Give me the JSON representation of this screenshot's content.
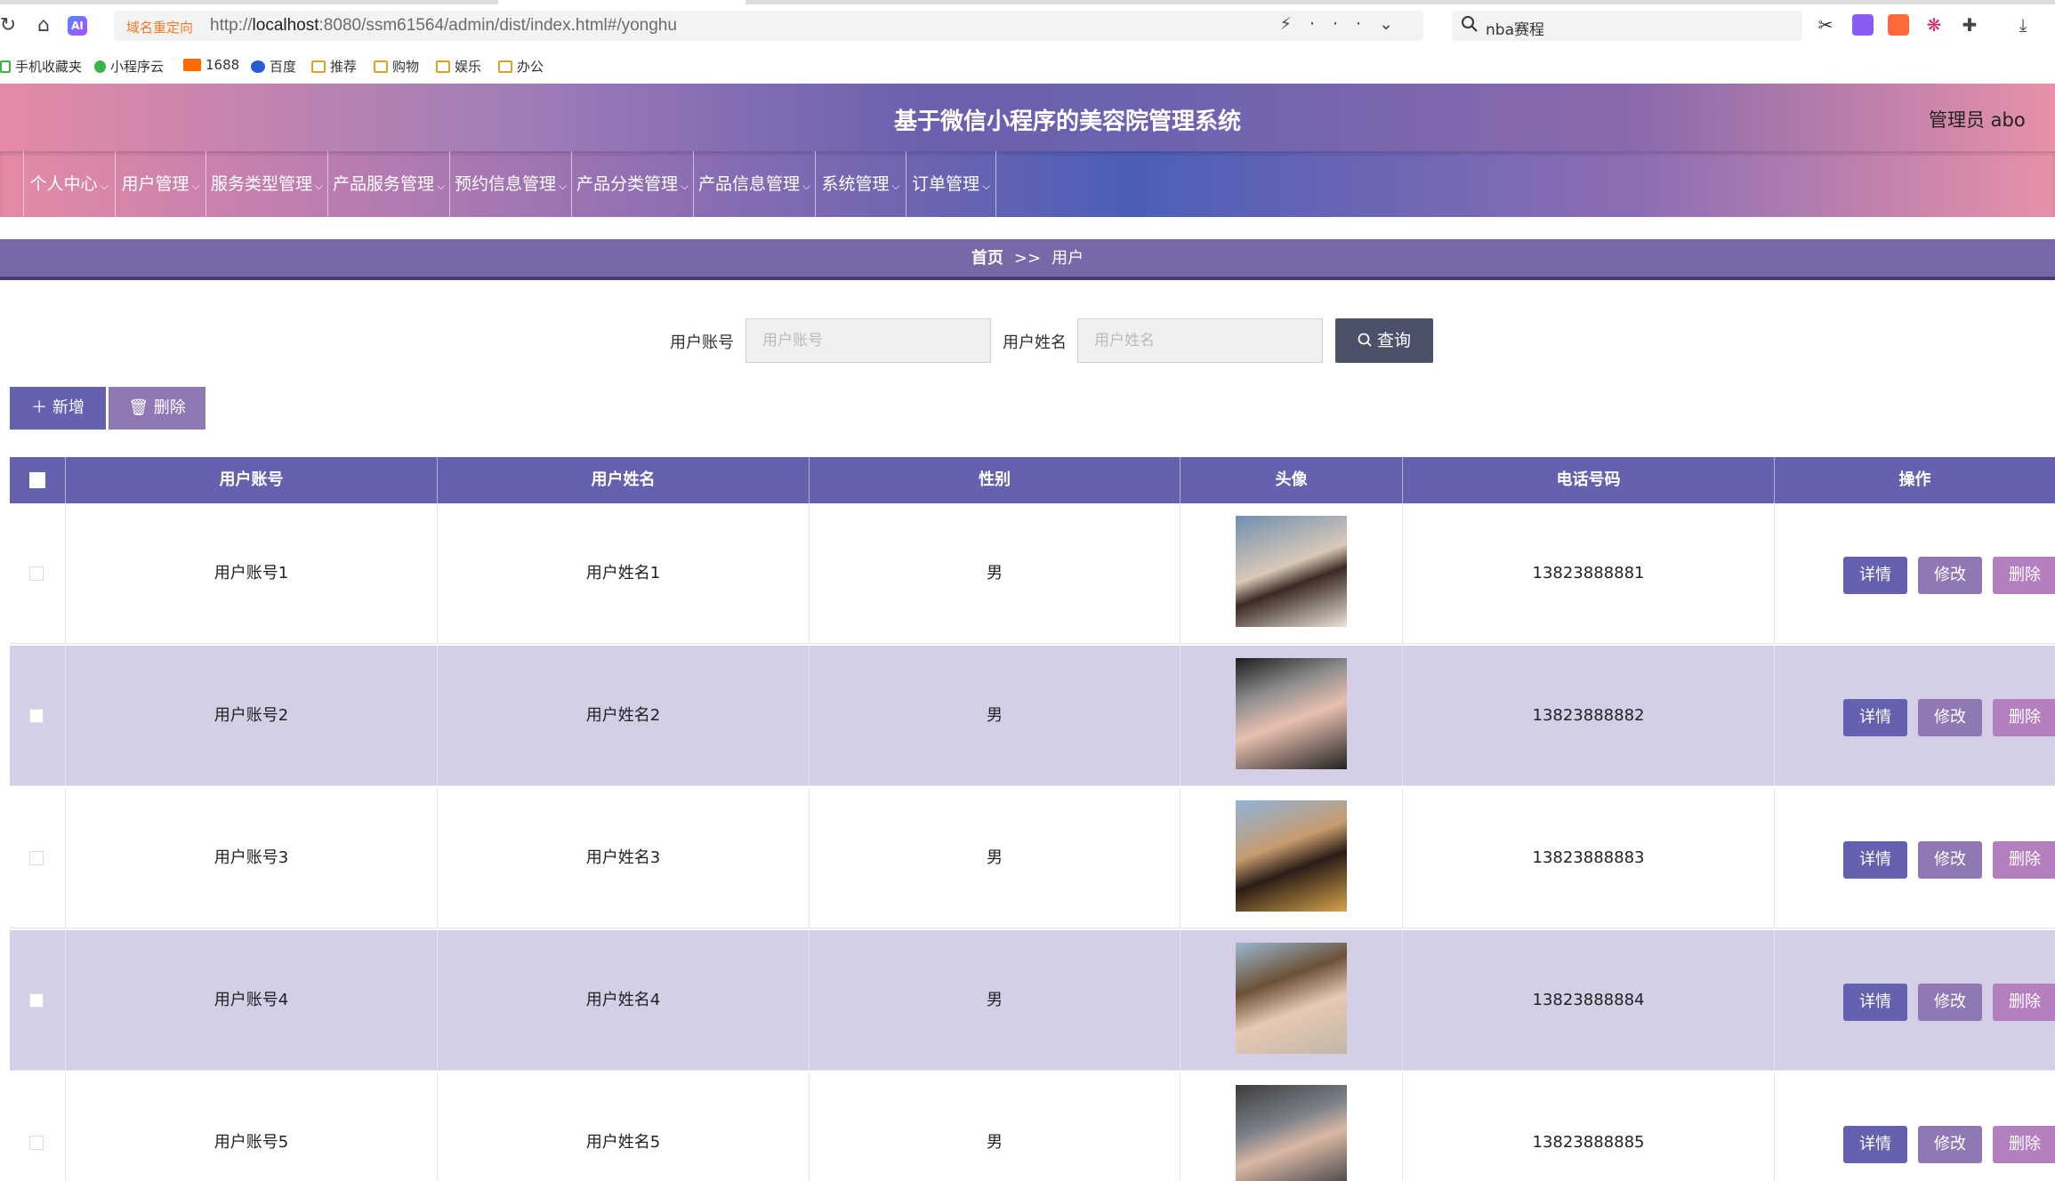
{
  "browser": {
    "redirect_label": "域名重定向",
    "url_prefix": "http://",
    "url_host": "localhost",
    "url_rest": ":8080/ssm61564/admin/dist/index.html#/yonghu",
    "search_query": "nba赛程",
    "bookmarks": [
      "手机收藏夹",
      "小程序云",
      "1688",
      "百度",
      "推荐",
      "购物",
      "娱乐",
      "办公"
    ]
  },
  "header": {
    "title": "基于微信小程序的美容院管理系统",
    "admin": "管理员 abo"
  },
  "menu": [
    "个人中心",
    "用户管理",
    "服务类型管理",
    "产品服务管理",
    "预约信息管理",
    "产品分类管理",
    "产品信息管理",
    "系统管理",
    "订单管理"
  ],
  "breadcrumb": {
    "home": "首页",
    "sep": ">>",
    "current": "用户"
  },
  "search": {
    "account_label": "用户账号",
    "account_placeholder": "用户账号",
    "name_label": "用户姓名",
    "name_placeholder": "用户姓名",
    "query_button": "查询"
  },
  "toolbar": {
    "add": "新增",
    "delete": "删除"
  },
  "table": {
    "headers": [
      "用户账号",
      "用户姓名",
      "性别",
      "头像",
      "电话号码",
      "操作"
    ],
    "actions": {
      "detail": "详情",
      "edit": "修改",
      "delete": "删除"
    },
    "rows": [
      {
        "account": "用户账号1",
        "name": "用户姓名1",
        "gender": "男",
        "phone": "13823888881"
      },
      {
        "account": "用户账号2",
        "name": "用户姓名2",
        "gender": "男",
        "phone": "13823888882"
      },
      {
        "account": "用户账号3",
        "name": "用户姓名3",
        "gender": "男",
        "phone": "13823888883"
      },
      {
        "account": "用户账号4",
        "name": "用户姓名4",
        "gender": "男",
        "phone": "13823888884"
      },
      {
        "account": "用户账号5",
        "name": "用户姓名5",
        "gender": "男",
        "phone": "13823888885"
      }
    ]
  }
}
